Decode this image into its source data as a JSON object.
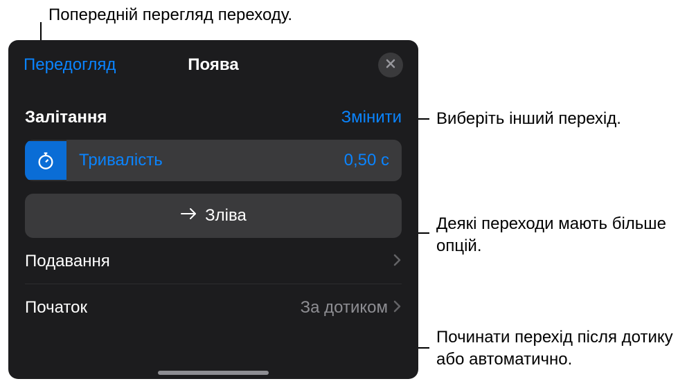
{
  "callouts": {
    "preview": "Попередній перегляд переходу.",
    "change": "Виберіть інший перехід.",
    "direction": "Деякі переходи мають більше опцій.",
    "start": "Починати перехід після дотику або автоматично."
  },
  "panel": {
    "preview_link": "Передогляд",
    "title": "Поява",
    "transition_name": "Залітання",
    "change_label": "Змінити",
    "duration_label": "Тривалість",
    "duration_value": "0,50 с",
    "direction_label": "Зліва",
    "delivery_label": "Подавання",
    "start_label": "Початок",
    "start_value": "За дотиком"
  }
}
